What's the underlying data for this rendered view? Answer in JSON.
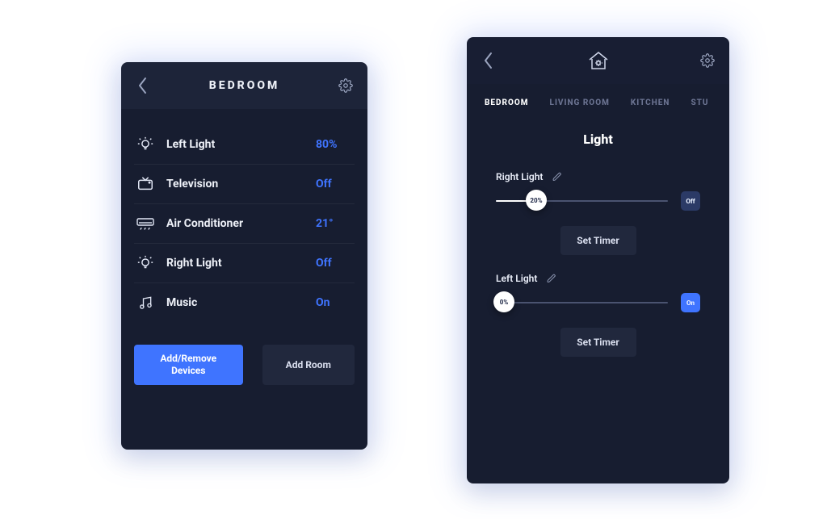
{
  "phoneA": {
    "title": "BEDROOM",
    "devices": [
      {
        "name": "Left Light",
        "value": "80%",
        "icon": "bulb"
      },
      {
        "name": "Television",
        "value": "Off",
        "icon": "tv"
      },
      {
        "name": "Air Conditioner",
        "value": "21°",
        "icon": "ac"
      },
      {
        "name": "Right Light",
        "value": "Off",
        "icon": "bulb"
      },
      {
        "name": "Music",
        "value": "On",
        "icon": "music"
      }
    ],
    "buttons": {
      "primary": "Add/Remove Devices",
      "secondary": "Add Room"
    }
  },
  "phoneB": {
    "tabs": [
      "BEDROOM",
      "LIVING ROOM",
      "KITCHEN",
      "STU"
    ],
    "activeTab": 0,
    "section_title": "Light",
    "sliders": [
      {
        "label": "Right Light",
        "percent": 20,
        "percent_text": "20%",
        "state": "Off",
        "timer": "Set Timer"
      },
      {
        "label": "Left Light",
        "percent": 0,
        "percent_text": "0%",
        "state": "On",
        "timer": "Set Timer"
      }
    ]
  }
}
